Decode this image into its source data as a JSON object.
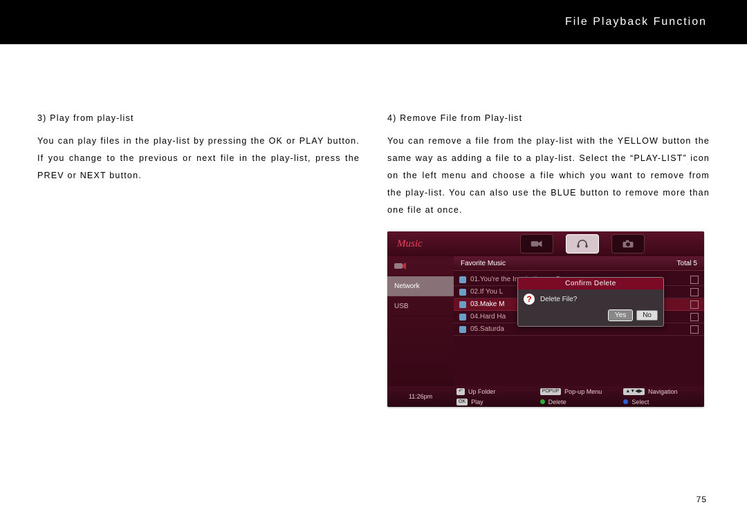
{
  "header": {
    "title": "File Playback Function"
  },
  "left": {
    "heading": "3) Play from play-list",
    "body": "You can play files in the play-list by pressing the OK or PLAY button. If you change to the previous or next file in the play-list, press the PREV or NEXT button."
  },
  "right": {
    "heading": "4) Remove File from Play-list",
    "body": "You can remove a file from the play-list with the YELLOW button the same way as adding a file to a play-list. Select the “PLAY-LIST” icon on the left menu and choose a file which you want to remove from the play-list. You can also use the BLUE button to remove more than one file at once."
  },
  "page_number": "75",
  "screenshot": {
    "app_label": "Music",
    "sidebar": {
      "items": [
        "",
        "Network",
        "USB"
      ]
    },
    "favorite_bar": {
      "left": "Favorite Music",
      "right": "Total 5"
    },
    "files": [
      "01.You're the Inspiration.mp3",
      "02.If You L",
      "03.Make M",
      "04.Hard Ha",
      "05.Saturda"
    ],
    "dialog": {
      "title": "Confirm Delete",
      "message": "Delete File?",
      "yes": "Yes",
      "no": "No"
    },
    "footer": {
      "time": "11:26pm",
      "actions": {
        "upfolder": "Up Folder",
        "popup": "Pop-up Menu",
        "navigation": "Navigation",
        "play": "Play",
        "delete": "Delete",
        "select": "Select"
      },
      "pills": {
        "back": "↶",
        "popup": "POPUP",
        "nav": "▲▼◀▶",
        "ok": "OK"
      }
    }
  }
}
